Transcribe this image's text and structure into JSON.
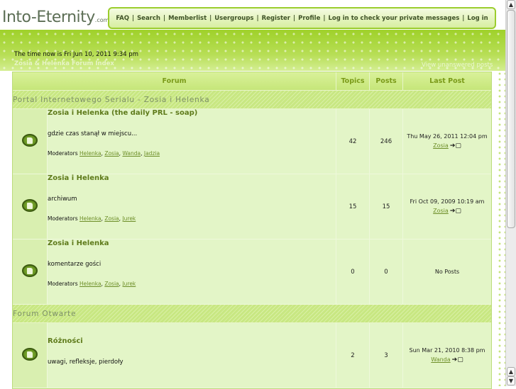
{
  "logo": {
    "main": "Into-Eternity",
    "suffix": ".com"
  },
  "topnav": [
    "FAQ",
    "Search",
    "Memberlist",
    "Usergroups",
    "Register",
    "Profile",
    "Log in to check your private messages",
    "Log in"
  ],
  "time_text": "The time now is Fri Jun 10, 2011 9:34 pm",
  "index_link": "Zosia & Helenka Forum Index",
  "unanswered_link": "View unanswered posts",
  "table_headers": {
    "forum": "Forum",
    "topics": "Topics",
    "posts": "Posts",
    "last_post": "Last Post"
  },
  "categories": [
    {
      "name": "Portal Internetowego Serialu - Zosia i Helenka",
      "forums": [
        {
          "name": "Zosia i Helenka (the daily PRL - soap)",
          "description": "gdzie czas stanął w miejscu...",
          "moderators_label": "Moderators",
          "moderators": [
            "Helenka",
            "Zosia",
            "Wanda",
            "Jadzia"
          ],
          "topics": "42",
          "posts": "246",
          "last_post_date": "Thu May 26, 2011 12:04 pm",
          "last_post_user": "Zosia"
        },
        {
          "name": "Zosia i Helenka",
          "description": "archiwum",
          "moderators_label": "Moderators",
          "moderators": [
            "Helenka",
            "Zosia",
            "Jurek"
          ],
          "topics": "15",
          "posts": "15",
          "last_post_date": "Fri Oct 09, 2009 10:19 am",
          "last_post_user": "Zosia"
        },
        {
          "name": "Zosia i Helenka",
          "description": "komentarze gości",
          "moderators_label": "Moderators",
          "moderators": [
            "Helenka",
            "Zosia",
            "Jurek"
          ],
          "topics": "0",
          "posts": "0",
          "last_post_date": "No Posts",
          "last_post_user": ""
        }
      ]
    },
    {
      "name": "Forum Otwarte",
      "forums": [
        {
          "name": "Różności",
          "description": "uwagi, refleksje, pierdoły",
          "moderators_label": "",
          "moderators": [],
          "topics": "2",
          "posts": "3",
          "last_post_date": "Sun Mar 21, 2010 8:38 pm",
          "last_post_user": "Wanda"
        }
      ]
    }
  ],
  "icons": {
    "forum_folder": "forum-folder-icon",
    "goto_last_post": "goto-last-post-icon"
  },
  "colors": {
    "brand_green": "#9fd12a",
    "link_green": "#6d8e28",
    "row_bg": "#e3f5c7"
  }
}
